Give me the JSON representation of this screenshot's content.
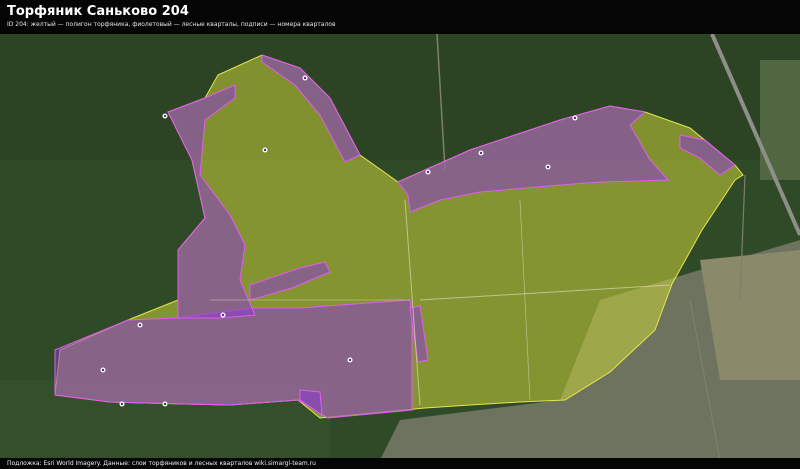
{
  "header": {
    "title": "Торфяник Саньково 204",
    "subtitle": "ID 204: желтый — полигон торфяника, фиолетовый — лесные кварталы, подписи — номера кварталов"
  },
  "footer": {
    "attribution": "Подложка: Esri World Imagery. Данные: слои торфяников и лесных кварталов wiki.simargl-team.ru"
  },
  "colors": {
    "peat_fill": "#c9d23a",
    "peat_outline": "#e6e64a",
    "forest_fill": "#8a3ad0",
    "forest_outline": "#e35bf0",
    "satellite_forest": "#2f4a27",
    "satellite_field": "#6d7a4e",
    "header_bg": "#050505"
  },
  "legend_layers": [
    {
      "name": "peat-bog-polygon",
      "color": "yellow"
    },
    {
      "name": "forest-quarters",
      "color": "purple"
    }
  ],
  "icons": [
    "quarter-marker-icon"
  ]
}
